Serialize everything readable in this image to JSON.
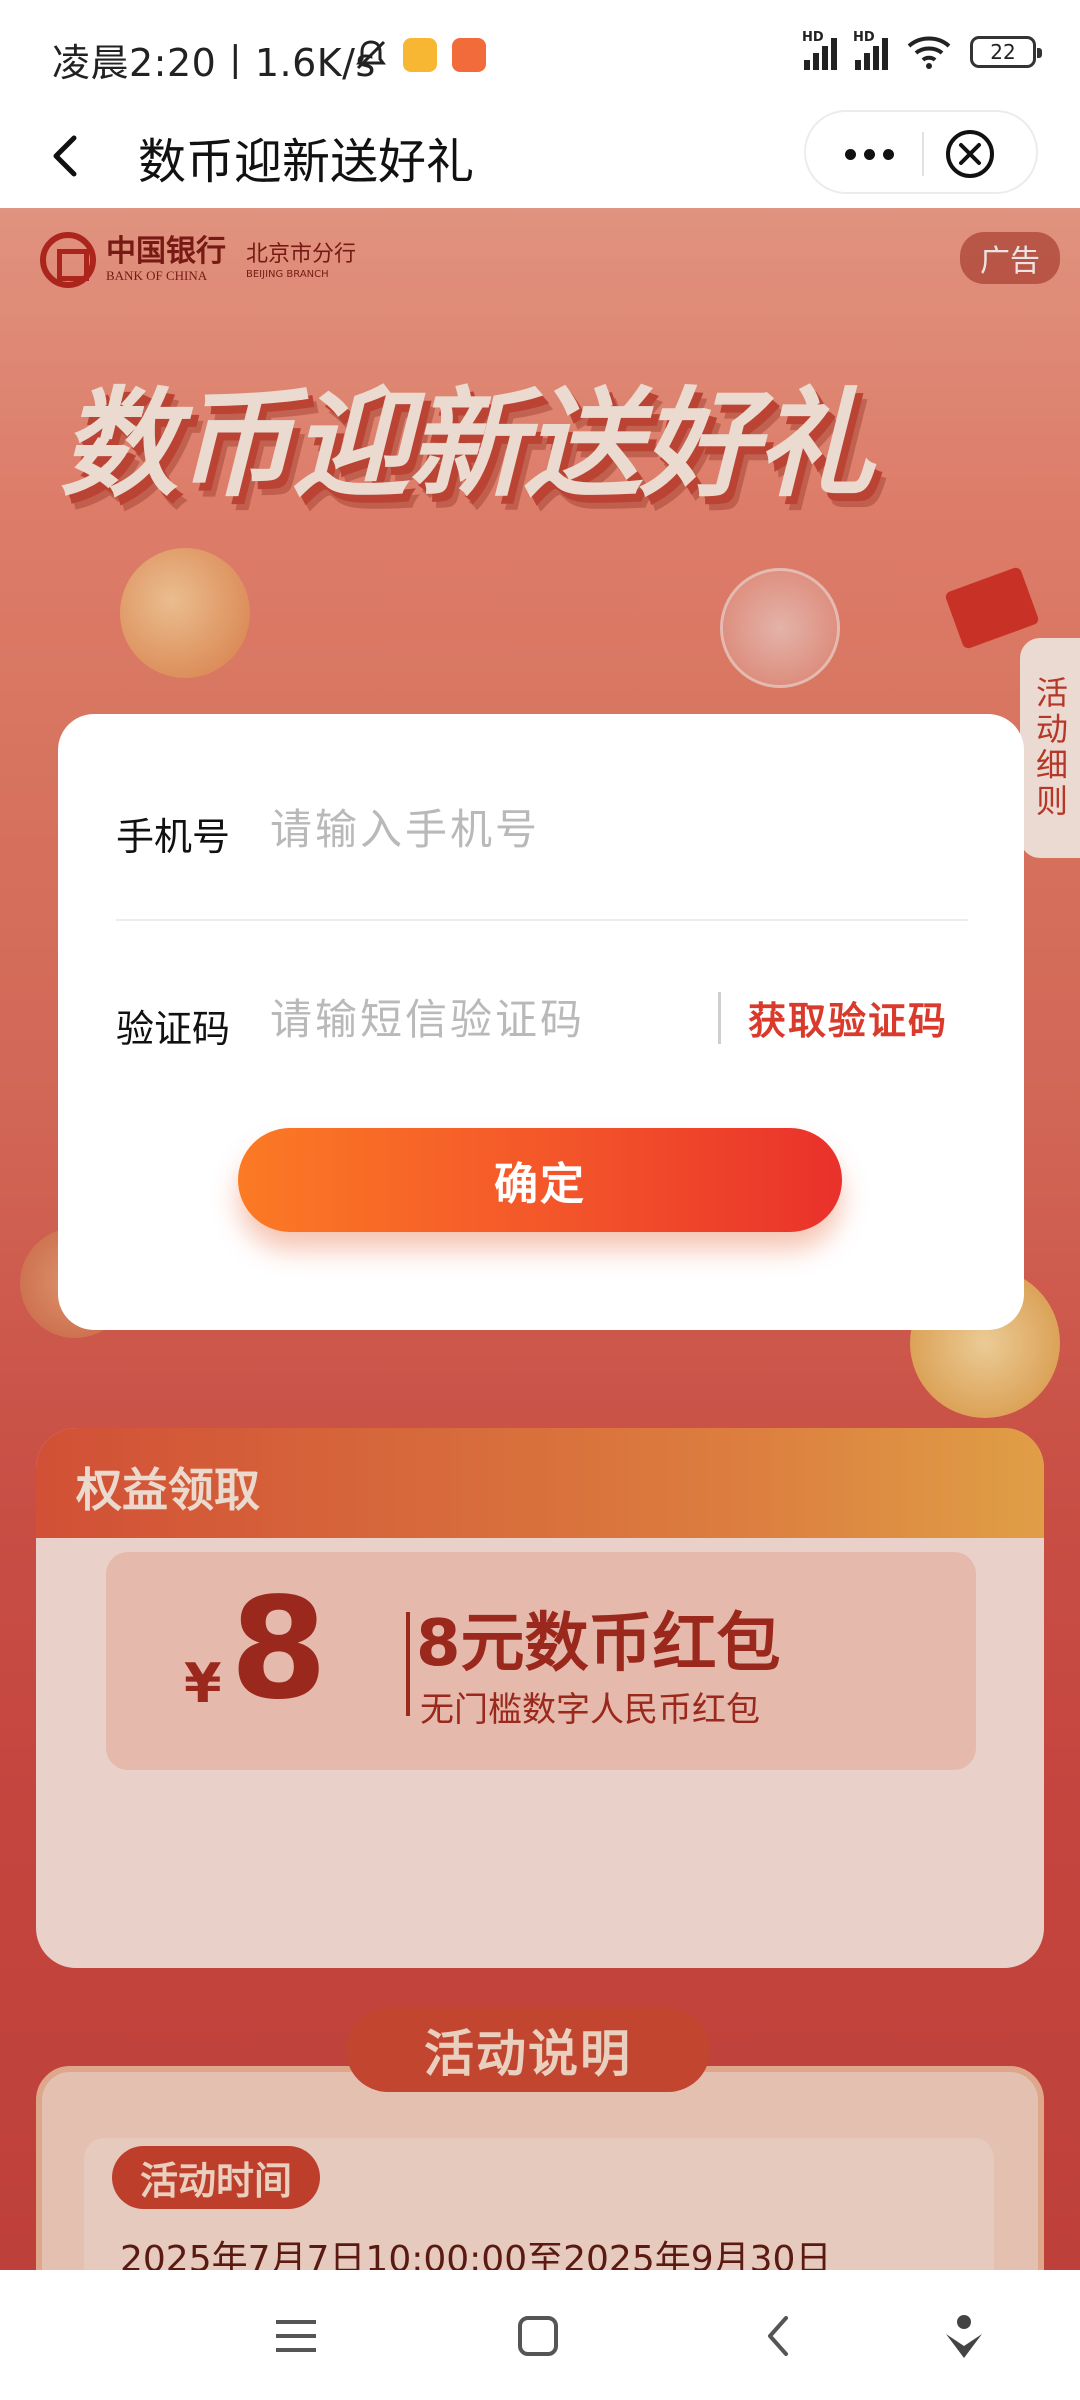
{
  "status_bar": {
    "time_speed": "凌晨2:20丨1.6K/s",
    "battery": "22",
    "sim1": "HD",
    "sim2": "HD"
  },
  "header": {
    "title": "数币迎新送好礼"
  },
  "banner": {
    "bank_name_cn": "中国银行",
    "bank_name_en": "BANK OF CHINA",
    "branch_cn": "北京市分行",
    "branch_en": "BEIJING BRANCH",
    "ad_badge": "广告",
    "hero_title": "数币迎新送好礼",
    "side_tab": "活动细则"
  },
  "benefits": {
    "title": "权益领取",
    "currency": "¥",
    "amount": "8",
    "name": "8元数币红包",
    "desc": "无门槛数字人民币红包"
  },
  "rules": {
    "title": "活动说明",
    "time_label": "活动时间",
    "time_text": "2025年7月7日10:00:00至2025年9月30日"
  },
  "modal": {
    "phone_label": "手机号",
    "phone_placeholder": "请输入手机号",
    "code_label": "验证码",
    "code_placeholder": "请输短信验证码",
    "get_code": "获取验证码",
    "confirm": "确定"
  },
  "colors": {
    "accent": "#e9312b",
    "button_start": "#fb7a24",
    "link_red": "#d93a2b"
  }
}
